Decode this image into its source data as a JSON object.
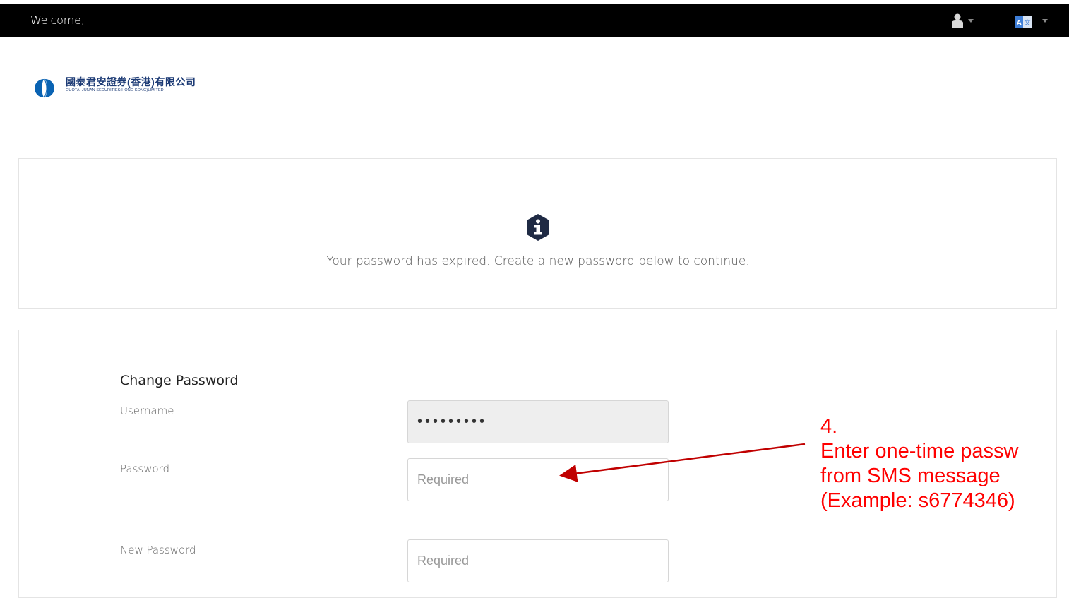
{
  "header": {
    "welcome": "Welcome,",
    "user_menu_icon": "user-icon",
    "language_menu_icon": "translate-icon"
  },
  "logo": {
    "chinese_name": "國泰君安證券(香港)有限公司",
    "english_name": "GUOTAI JUNAN SECURITIES(HONG KONG)LIMITED",
    "brand_color": "#1d3b75"
  },
  "notice": {
    "icon": "info-icon",
    "message": "Your password has expired. Create a new password below to continue."
  },
  "form": {
    "title": "Change Password",
    "username_label": "Username",
    "username_value": "•••••••••",
    "password_label": "Password",
    "password_placeholder": "Required",
    "new_password_label": "New Password",
    "new_password_placeholder": "Required"
  },
  "annotation": {
    "step": "4.",
    "line1": "Enter one-time passw",
    "line2": "from SMS message",
    "line3": "(Example: s6774346)",
    "color": "#ff0000"
  }
}
